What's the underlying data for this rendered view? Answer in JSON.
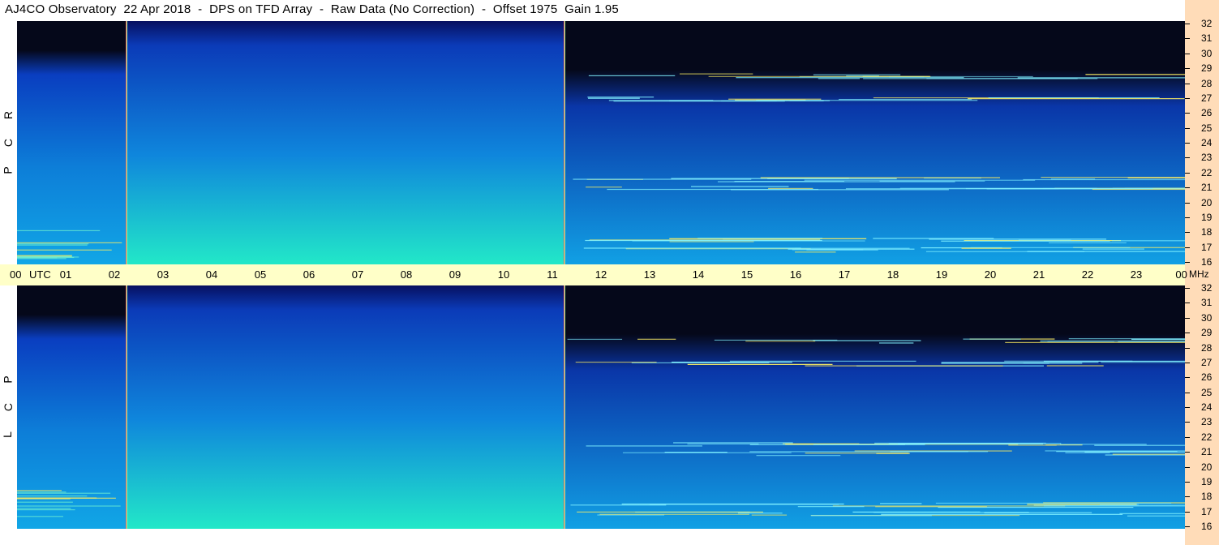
{
  "header": {
    "title": "AJ4CO Observatory  22 Apr 2018  -  DPS on TFD Array  -  Raw Data (No Correction)  -  Offset 1975  Gain 1.95"
  },
  "panels": [
    {
      "name": "rcp",
      "letters": [
        "R",
        "C",
        "P"
      ]
    },
    {
      "name": "lcp",
      "letters": [
        "L",
        "C",
        "P"
      ]
    }
  ],
  "time_axis": {
    "unit_label": "UTC",
    "labels": [
      "00",
      "01",
      "02",
      "03",
      "04",
      "05",
      "06",
      "07",
      "08",
      "09",
      "10",
      "11",
      "12",
      "13",
      "14",
      "15",
      "16",
      "17",
      "18",
      "19",
      "20",
      "21",
      "22",
      "23",
      "00"
    ]
  },
  "freq_axis": {
    "unit_label": "MHz",
    "labels": [
      "32",
      "31",
      "30",
      "29",
      "28",
      "27",
      "26",
      "25",
      "24",
      "23",
      "22",
      "21",
      "20",
      "19",
      "18",
      "17",
      "16"
    ]
  },
  "colors": {
    "background_night": "#05081a",
    "low_intensity": "#0a3ec0",
    "mid_intensity": "#11a6e6",
    "high_intensity": "#22e8c8",
    "interference": "#fff060",
    "marker_line": "#ff6060",
    "time_band": "#ffffc8",
    "freq_band": "#ffdcb8"
  },
  "chart_data": {
    "type": "heatmap",
    "title": "AJ4CO Observatory  22 Apr 2018  -  DPS on TFD Array  -  Raw Data (No Correction)  -  Offset 1975  Gain 1.95",
    "x_axis": {
      "label": "UTC",
      "range": [
        0,
        24
      ],
      "unit": "hours"
    },
    "y_axis": {
      "label": "MHz",
      "range": [
        16,
        32
      ]
    },
    "series": [
      {
        "name": "RCP",
        "markers_utc": [
          2.25,
          11.25
        ]
      },
      {
        "name": "LCP",
        "markers_utc": [
          2.25,
          11.25
        ]
      }
    ],
    "interference_bands_mhz": [
      17.0,
      17.6,
      21.0,
      21.6,
      26.9,
      28.4
    ],
    "grid": false
  }
}
